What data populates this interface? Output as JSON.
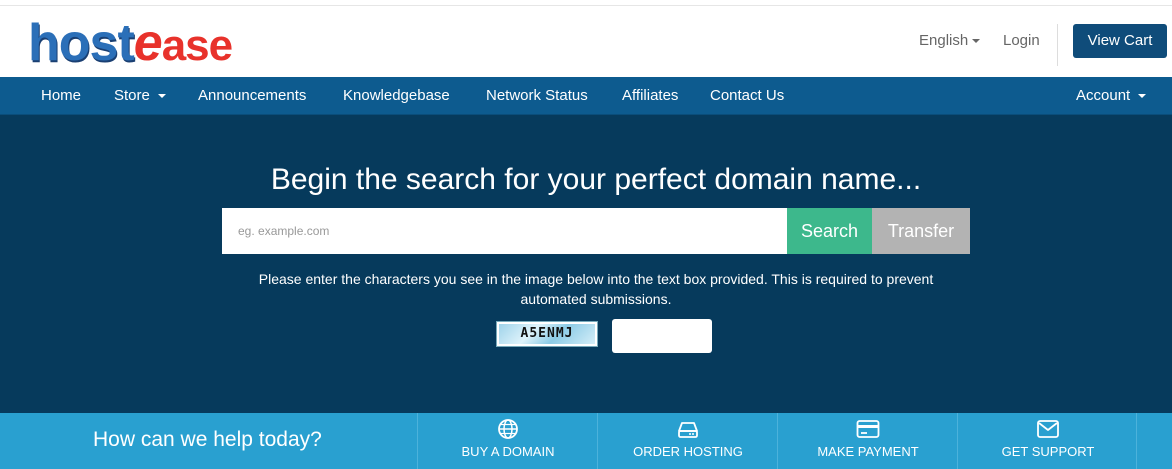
{
  "header": {
    "logo": {
      "part1": "host",
      "part2": "e",
      "part3": "ase"
    },
    "language": "English",
    "login": "Login",
    "view_cart": "View Cart"
  },
  "nav": {
    "home": "Home",
    "store": "Store",
    "announcements": "Announcements",
    "knowledgebase": "Knowledgebase",
    "network_status": "Network Status",
    "affiliates": "Affiliates",
    "contact_us": "Contact Us",
    "account": "Account"
  },
  "hero": {
    "title": "Begin the search for your perfect domain name...",
    "search_placeholder": "eg. example.com",
    "search_button": "Search",
    "transfer_button": "Transfer",
    "captcha_instructions": "Please enter the characters you see in the image below into the text box provided. This is required to prevent automated submissions.",
    "captcha_code": "A5ENMJ"
  },
  "help": {
    "title": "How can we help today?",
    "items": [
      {
        "label": "BUY A DOMAIN",
        "icon": "globe-icon"
      },
      {
        "label": "ORDER HOSTING",
        "icon": "server-icon"
      },
      {
        "label": "MAKE PAYMENT",
        "icon": "credit-card-icon"
      },
      {
        "label": "GET SUPPORT",
        "icon": "envelope-icon"
      }
    ]
  },
  "colors": {
    "nav_bg": "#0d5b8f",
    "hero_bg": "#063a5c",
    "search_btn": "#3db88c",
    "transfer_btn": "#b3b3b3",
    "help_bar": "#29a0d0",
    "view_cart": "#0f4c7a"
  }
}
